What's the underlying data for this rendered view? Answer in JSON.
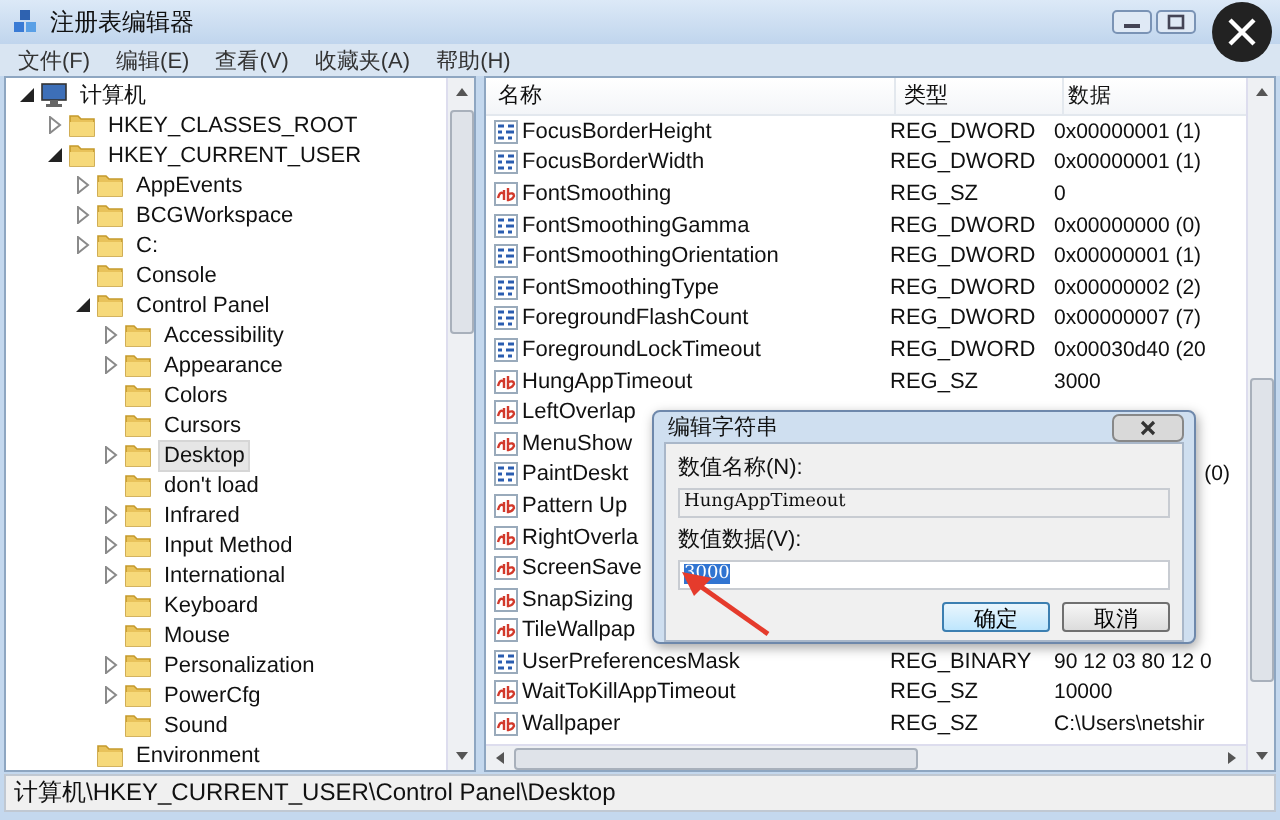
{
  "window": {
    "title": "注册表编辑器"
  },
  "menu": [
    "文件(F)",
    "编辑(E)",
    "查看(V)",
    "收藏夹(A)",
    "帮助(H)"
  ],
  "tree": [
    {
      "label": "计算机",
      "kind": "computer",
      "expanded": true,
      "selected": false,
      "children": [
        {
          "label": "HKEY_CLASSES_ROOT",
          "kind": "branch",
          "expanded": false,
          "selected": false
        },
        {
          "label": "HKEY_CURRENT_USER",
          "kind": "branch",
          "expanded": true,
          "selected": false,
          "children": [
            {
              "label": "AppEvents",
              "kind": "branch",
              "expanded": false,
              "selected": false
            },
            {
              "label": "BCGWorkspace",
              "kind": "branch",
              "expanded": false,
              "selected": false
            },
            {
              "label": "C:",
              "kind": "branch",
              "expanded": false,
              "selected": false
            },
            {
              "label": "Console",
              "kind": "leaf",
              "selected": false
            },
            {
              "label": "Control Panel",
              "kind": "branch",
              "expanded": true,
              "selected": false,
              "children": [
                {
                  "label": "Accessibility",
                  "kind": "branch",
                  "expanded": false,
                  "selected": false
                },
                {
                  "label": "Appearance",
                  "kind": "branch",
                  "expanded": false,
                  "selected": false
                },
                {
                  "label": "Colors",
                  "kind": "leaf",
                  "selected": false
                },
                {
                  "label": "Cursors",
                  "kind": "leaf",
                  "selected": false
                },
                {
                  "label": "Desktop",
                  "kind": "branch",
                  "expanded": false,
                  "selected": true
                },
                {
                  "label": "don't load",
                  "kind": "leaf",
                  "selected": false
                },
                {
                  "label": "Infrared",
                  "kind": "branch",
                  "expanded": false,
                  "selected": false
                },
                {
                  "label": "Input Method",
                  "kind": "branch",
                  "expanded": false,
                  "selected": false
                },
                {
                  "label": "International",
                  "kind": "branch",
                  "expanded": false,
                  "selected": false
                },
                {
                  "label": "Keyboard",
                  "kind": "leaf",
                  "selected": false
                },
                {
                  "label": "Mouse",
                  "kind": "leaf",
                  "selected": false
                },
                {
                  "label": "Personalization",
                  "kind": "branch",
                  "expanded": false,
                  "selected": false
                },
                {
                  "label": "PowerCfg",
                  "kind": "branch",
                  "expanded": false,
                  "selected": false
                },
                {
                  "label": "Sound",
                  "kind": "leaf",
                  "selected": false
                }
              ]
            },
            {
              "label": "Environment",
              "kind": "leaf",
              "selected": false
            }
          ]
        }
      ]
    }
  ],
  "list": {
    "columns": [
      "名称",
      "类型",
      "数据"
    ],
    "rows": [
      {
        "name": "FocusBorderHeight",
        "kind": "binary",
        "type": "REG_DWORD",
        "data": "0x00000001 (1)"
      },
      {
        "name": "FocusBorderWidth",
        "kind": "binary",
        "type": "REG_DWORD",
        "data": "0x00000001 (1)"
      },
      {
        "name": "FontSmoothing",
        "kind": "string",
        "type": "REG_SZ",
        "data": "0"
      },
      {
        "name": "FontSmoothingGamma",
        "kind": "binary",
        "type": "REG_DWORD",
        "data": "0x00000000 (0)"
      },
      {
        "name": "FontSmoothingOrientation",
        "kind": "binary",
        "type": "REG_DWORD",
        "data": "0x00000001 (1)"
      },
      {
        "name": "FontSmoothingType",
        "kind": "binary",
        "type": "REG_DWORD",
        "data": "0x00000002 (2)"
      },
      {
        "name": "ForegroundFlashCount",
        "kind": "binary",
        "type": "REG_DWORD",
        "data": "0x00000007 (7)"
      },
      {
        "name": "ForegroundLockTimeout",
        "kind": "binary",
        "type": "REG_DWORD",
        "data": "0x00030d40 (20"
      },
      {
        "name": "HungAppTimeout",
        "kind": "string",
        "type": "REG_SZ",
        "data": "3000"
      },
      {
        "name": "LeftOverlap",
        "kind": "string"
      },
      {
        "name": "MenuShow",
        "kind": "string"
      },
      {
        "name": "PaintDeskt",
        "kind": "binary",
        "data": "(0)"
      },
      {
        "name": "Pattern Up",
        "kind": "string"
      },
      {
        "name": "RightOverla",
        "kind": "string"
      },
      {
        "name": "ScreenSave",
        "kind": "string"
      },
      {
        "name": "SnapSizing",
        "kind": "string"
      },
      {
        "name": "TileWallpap",
        "kind": "string"
      },
      {
        "name": "UserPreferencesMask",
        "kind": "binary",
        "type": "REG_BINARY",
        "data": "90 12 03 80 12 0"
      },
      {
        "name": "WaitToKillAppTimeout",
        "kind": "string",
        "type": "REG_SZ",
        "data": "10000"
      },
      {
        "name": "Wallpaper",
        "kind": "string",
        "type": "REG_SZ",
        "data": "C:\\Users\\netshir"
      }
    ]
  },
  "dialog": {
    "title": "编辑字符串",
    "name_label": "数值名称(N):",
    "name_value": "HungAppTimeout",
    "data_label": "数值数据(V):",
    "data_value": "3000",
    "data_selected": true,
    "buttons": [
      {
        "label": "确定",
        "default": true
      },
      {
        "label": "取消",
        "default": false
      }
    ]
  },
  "status_bar": "计算机\\HKEY_CURRENT_USER\\Control Panel\\Desktop"
}
